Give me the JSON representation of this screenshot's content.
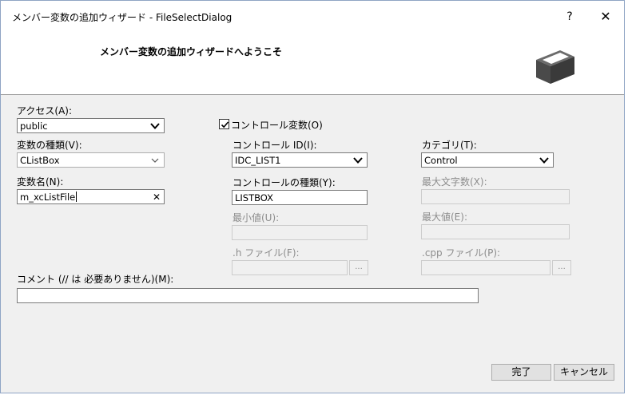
{
  "window": {
    "title": "メンバー変数の追加ウィザード - FileSelectDialog",
    "help_label": "?",
    "close_label": "✕"
  },
  "header": {
    "title": "メンバー変数の追加ウィザードへようこそ",
    "icon": "box-icon"
  },
  "form": {
    "access": {
      "label": "アクセス(A):",
      "value": "public"
    },
    "var_type": {
      "label": "変数の種類(V):",
      "value": "CListBox"
    },
    "var_name": {
      "label": "変数名(N):",
      "value": "m_xcListFile"
    },
    "control_var": {
      "label": "コントロール変数(O)",
      "checked": true
    },
    "control_id": {
      "label": "コントロール ID(I):",
      "value": "IDC_LIST1"
    },
    "control_type": {
      "label": "コントロールの種類(Y):",
      "value": "LISTBOX"
    },
    "min_value": {
      "label": "最小値(U):",
      "value": ""
    },
    "h_file": {
      "label": ".h ファイル(F):",
      "value": "",
      "browse_label": "..."
    },
    "category": {
      "label": "カテゴリ(T):",
      "value": "Control"
    },
    "max_chars": {
      "label": "最大文字数(X):",
      "value": ""
    },
    "max_value": {
      "label": "最大値(E):",
      "value": ""
    },
    "cpp_file": {
      "label": ".cpp ファイル(P):",
      "value": "",
      "browse_label": "..."
    },
    "comment": {
      "label": "コメント (// は 必要ありません)(M):",
      "value": ""
    }
  },
  "buttons": {
    "finish": "完了",
    "cancel": "キャンセル"
  }
}
